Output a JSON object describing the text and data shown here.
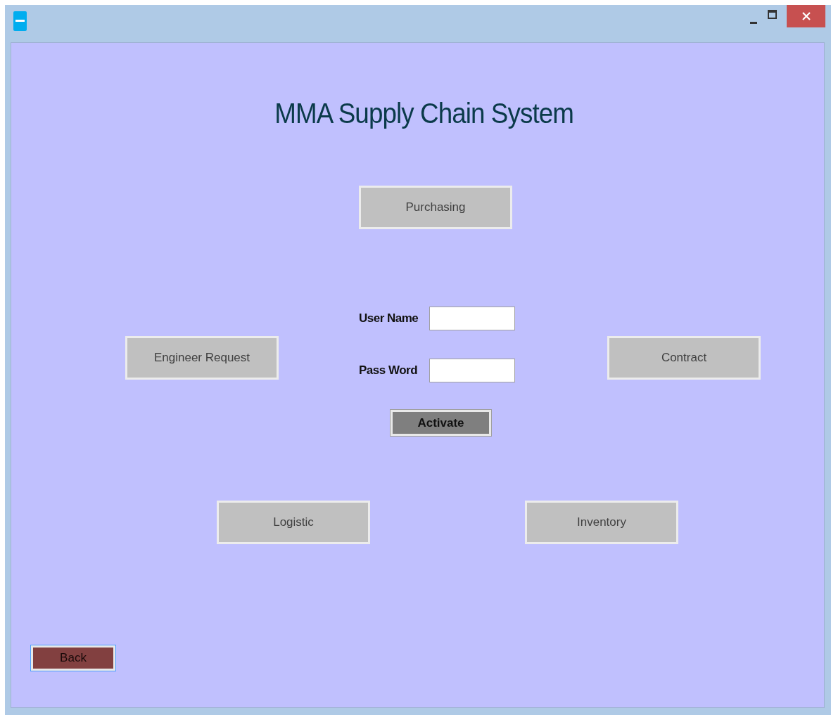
{
  "title": "MMA Supply Chain System",
  "modules": {
    "top": "Purchasing",
    "left": "Engineer Request",
    "right": "Contract",
    "bottom_left": "Logistic",
    "bottom_right": "Inventory"
  },
  "login": {
    "fields": [
      {
        "label": "User Name"
      },
      {
        "label": "Pass Word"
      }
    ],
    "button": "Activate"
  },
  "back_button": "Back"
}
